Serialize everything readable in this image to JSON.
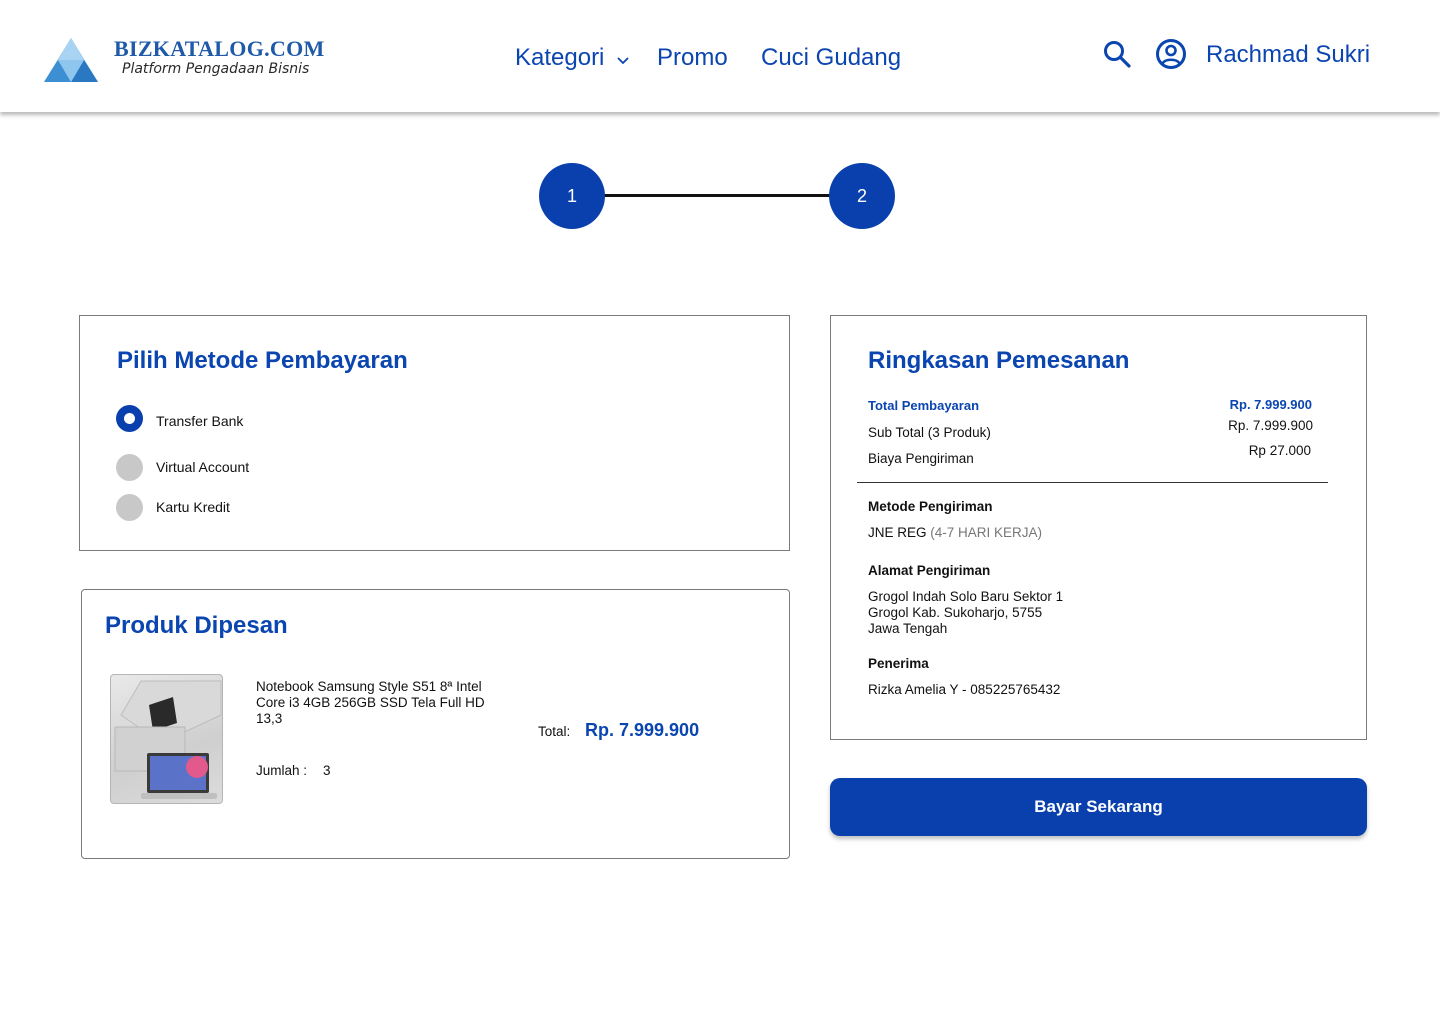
{
  "header": {
    "logo_title": "BIZKATALOG.COM",
    "logo_subtitle": "Platform Pengadaan Bisnis",
    "nav": {
      "kategori": "Kategori",
      "promo": "Promo",
      "cuci_gudang": "Cuci Gudang"
    },
    "user_name": "Rachmad Sukri",
    "icons": [
      "search-icon",
      "user-circle-icon",
      "chevron-down-icon"
    ]
  },
  "stepper": {
    "steps": [
      "1",
      "2"
    ]
  },
  "payment": {
    "title": "Pilih Metode Pembayaran",
    "options": [
      {
        "label": "Transfer Bank",
        "selected": true
      },
      {
        "label": "Virtual Account",
        "selected": false
      },
      {
        "label": "Kartu Kredit",
        "selected": false
      }
    ]
  },
  "products": {
    "title": "Produk Dipesan",
    "items": [
      {
        "name": "Notebook Samsung Style S51 8ª Intel Core i3 4GB 256GB SSD Tela Full HD 13,3",
        "qty_label": "Jumlah :",
        "qty": "3",
        "total_label": "Total:",
        "total": "Rp. 7.999.900"
      }
    ]
  },
  "summary": {
    "title": "Ringkasan Pemesanan",
    "total_label": "Total Pembayaran",
    "total_value": "Rp. 7.999.900",
    "subtotal_label": "Sub Total (3 Produk)",
    "subtotal_value": "Rp. 7.999.900",
    "shipping_label": "Biaya Pengiriman",
    "shipping_value": "Rp 27.000",
    "method_label": "Metode  Pengiriman",
    "method_value": "JNE REG",
    "method_note": "(4-7 HARI KERJA)",
    "address_label": "Alamat Pengiriman",
    "address_lines": [
      "Grogol Indah Solo Baru Sektor 1",
      "Grogol Kab. Sukoharjo, 5755",
      "Jawa Tengah"
    ],
    "recipient_label": "Penerima",
    "recipient_value": "Rizka Amelia Y - 085225765432"
  },
  "actions": {
    "pay_label": "Bayar Sekarang"
  },
  "colors": {
    "primary": "#0a40ad",
    "link": "#0a45b0",
    "radio_inactive": "#c8c8c8"
  }
}
